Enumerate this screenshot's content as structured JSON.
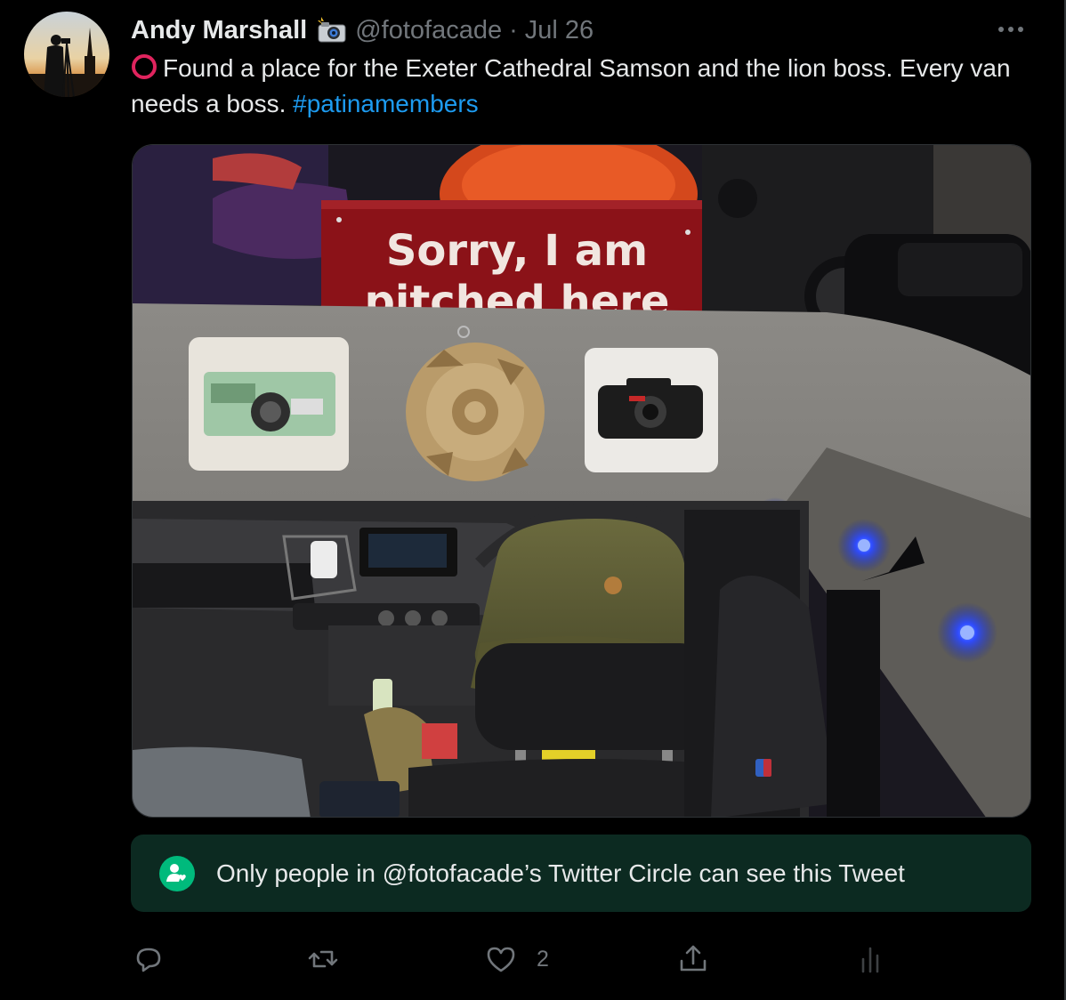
{
  "tweet": {
    "author": {
      "display_name": "Andy Marshall",
      "badge_emoji": "camera-with-flash-emoji",
      "handle": "@fotofacade",
      "separator": "·",
      "date": "Jul 26"
    },
    "text": {
      "icon": "red-ring-icon",
      "main": "Found a place for the Exeter Cathedral Samson and the lion boss. Every van needs a boss.",
      "hashtag": "#patinamembers"
    },
    "media": {
      "sign_text_line1": "Sorry, I am",
      "sign_text_line2": "pitched here"
    },
    "circle_notice": {
      "icon": "twitter-circle-icon",
      "text": "Only people in @fotofacade’s Twitter Circle can see this Tweet"
    },
    "actions": {
      "reply_icon": "reply-icon",
      "retweet_icon": "retweet-icon",
      "like_icon": "heart-icon",
      "like_count": "2",
      "share_icon": "share-icon",
      "analytics_icon": "analytics-icon"
    }
  },
  "colors": {
    "background": "#000000",
    "text": "#e7e9ea",
    "muted": "#71767b",
    "link": "#1d9bf0",
    "circle_bg": "#0c2a21",
    "circle_icon": "#00ba7c",
    "ring": "#e0245e"
  }
}
